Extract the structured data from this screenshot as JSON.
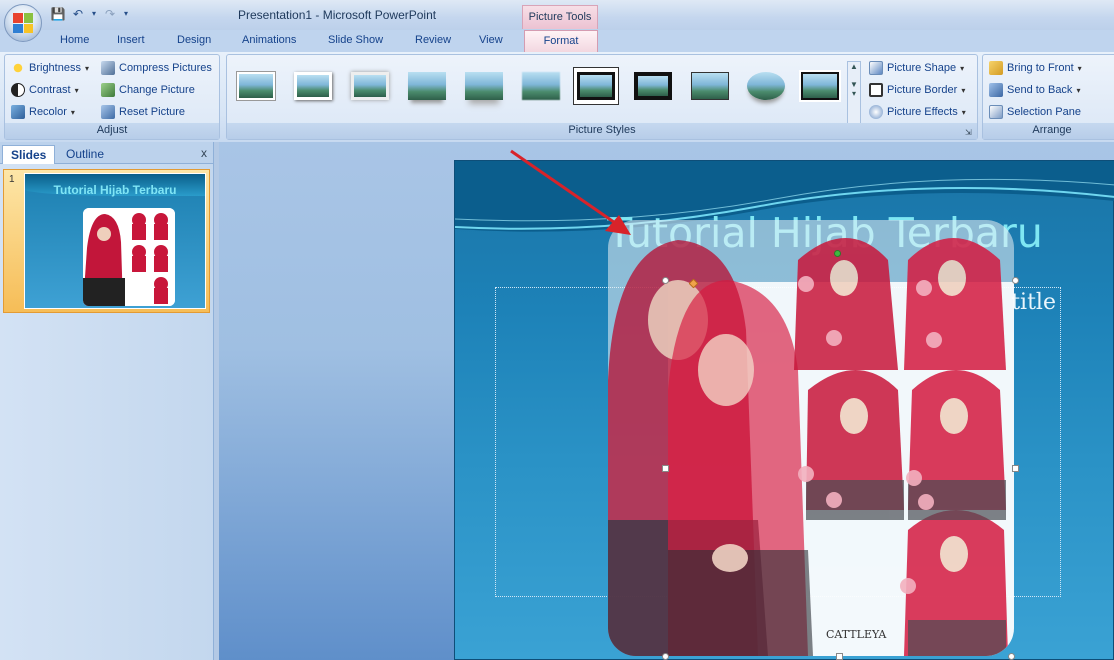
{
  "window": {
    "title": "Presentation1 - Microsoft PowerPoint",
    "context_tab_group": "Picture Tools"
  },
  "tabs": [
    "Home",
    "Insert",
    "Design",
    "Animations",
    "Slide Show",
    "Review",
    "View"
  ],
  "active_tab": "Format",
  "ribbon": {
    "adjust": {
      "label": "Adjust",
      "brightness": "Brightness",
      "contrast": "Contrast",
      "recolor": "Recolor",
      "compress": "Compress Pictures",
      "change": "Change Picture",
      "reset": "Reset Picture"
    },
    "picture_styles": {
      "label": "Picture Styles",
      "shape": "Picture Shape",
      "border": "Picture Border",
      "effects": "Picture Effects",
      "style_count": 11
    },
    "arrange": {
      "label": "Arrange",
      "bring_front": "Bring to Front",
      "send_back": "Send to Back",
      "selection_pane": "Selection Pane"
    }
  },
  "slides_panel": {
    "tab_slides": "Slides",
    "tab_outline": "Outline",
    "close": "x",
    "slide_number": "1",
    "thumb_title": "Tutorial Hijab Terbaru"
  },
  "slide": {
    "title": "Tutorial Hijab Terbaru",
    "placeholder_text": "title",
    "brand_text": "CATTLEYA"
  },
  "colors": {
    "ribbon_bg": "#dbe7f6",
    "context_tab": "#f2d6df",
    "slide_bg": "#1d82b8",
    "title_text": "#7fe7f3",
    "arrow": "#d8232a",
    "hijab_red": "#d0173a"
  }
}
